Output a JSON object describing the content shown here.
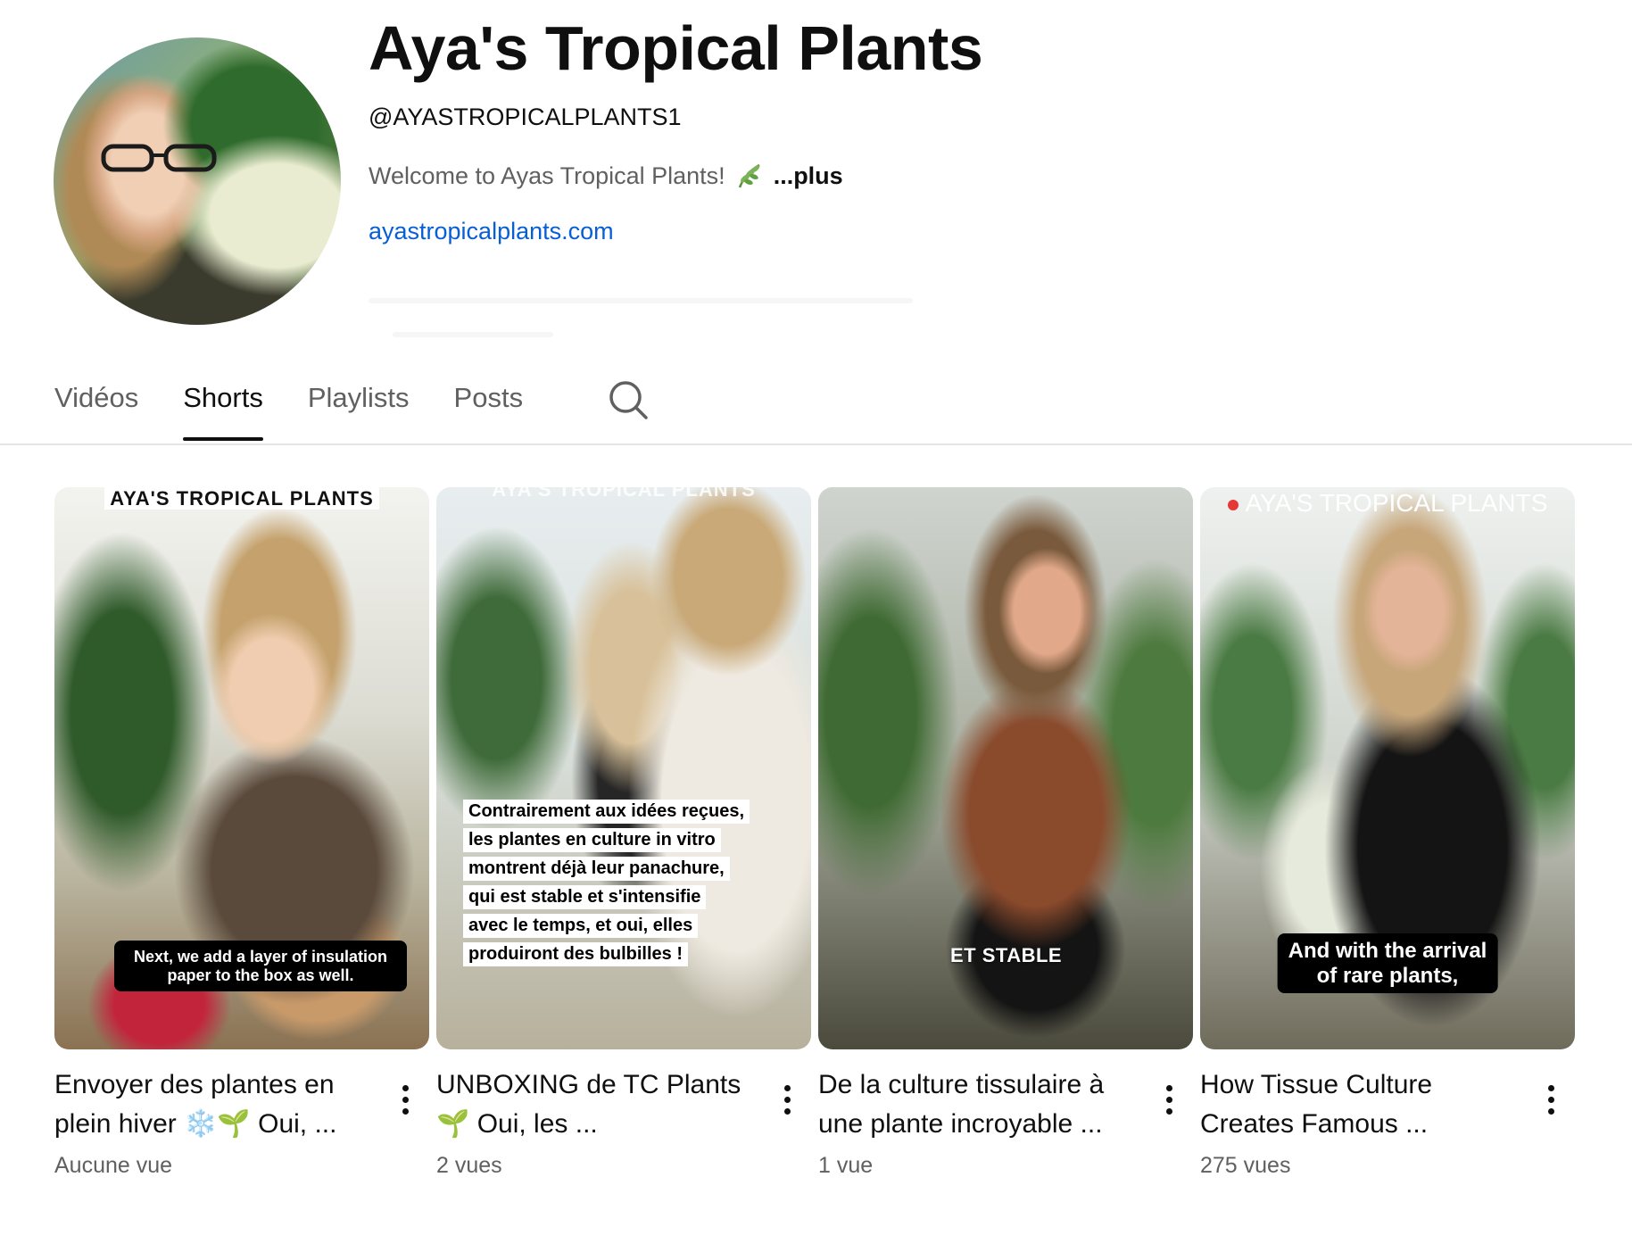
{
  "channel": {
    "name": "Aya's Tropical Plants",
    "handle": "@AYASTROPICALPLANTS1",
    "description": "Welcome to Ayas Tropical Plants!",
    "description_more": "...plus",
    "link": "ayastropicalplants.com"
  },
  "tabs": [
    {
      "label": "Vidéos",
      "active": false
    },
    {
      "label": "Shorts",
      "active": true
    },
    {
      "label": "Playlists",
      "active": false
    },
    {
      "label": "Posts",
      "active": false
    }
  ],
  "icons": {
    "description_emoji": "leaf-icon",
    "tab_search": "search-icon",
    "card_menu": "more-vert-icon"
  },
  "colors": {
    "link": "#065fd4",
    "muted_text": "#606060",
    "active_tab_underline": "#0f0f0f"
  },
  "shorts": [
    {
      "title": "Envoyer des plantes en plein hiver ❄️🌱 Oui, ...",
      "views": "Aucune vue",
      "watermark": "AYA'S TROPICAL PLANTS",
      "caption_lines": [
        "Next, we add a layer of insulation",
        "paper to the box as well."
      ]
    },
    {
      "title": "UNBOXING de TC Plants 🌱 Oui, les ...",
      "views": "2 vues",
      "watermark": "AYA'S TROPICAL PLANTS",
      "caption_lines": [
        "Contrairement aux idées reçues,",
        "les plantes en culture in vitro",
        "montrent déjà leur panachure,",
        "qui est stable et s'intensifie",
        "avec le temps, et oui, elles",
        "produiront des bulbilles !"
      ]
    },
    {
      "title": "De la culture tissulaire à une plante incroyable ...",
      "views": "1 vue",
      "overlay_text": "ET STABLE"
    },
    {
      "title": "How Tissue Culture Creates Famous ...",
      "views": "275 vues",
      "watermark": "AYA'S TROPICAL PLANTS",
      "caption_lines": [
        "And with the arrival",
        "of rare plants,"
      ]
    }
  ]
}
